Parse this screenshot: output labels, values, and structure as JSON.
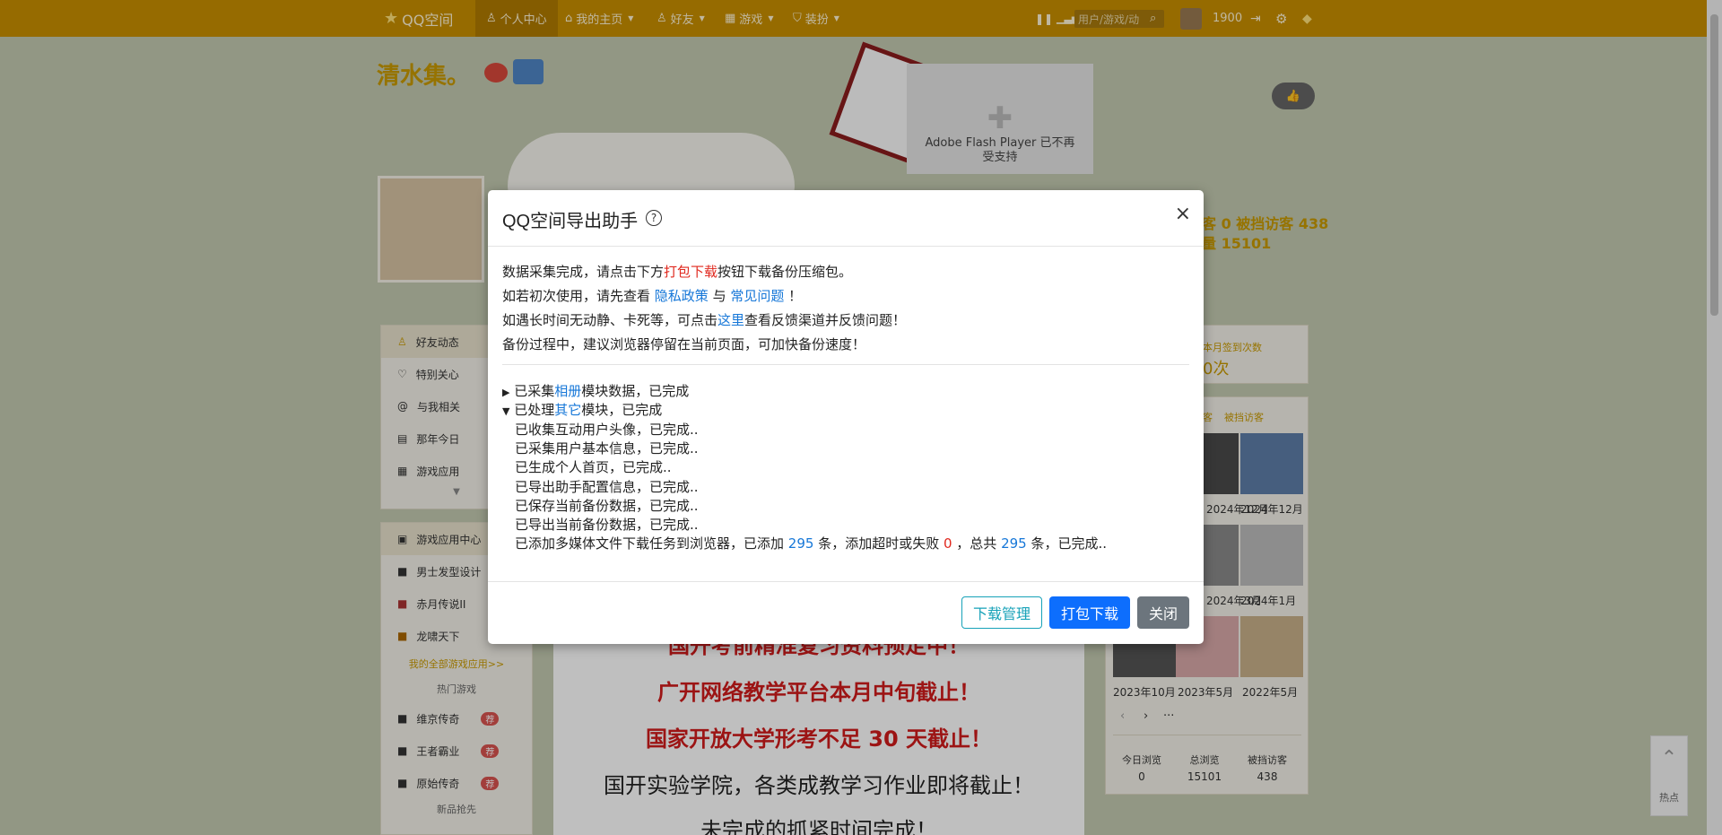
{
  "topbar": {
    "logo": "QQ空间",
    "personal": "个人中心",
    "home": "我的主页",
    "friends": "好友",
    "games": "游戏",
    "dress": "装扮",
    "search_placeholder": "用户/游戏/动",
    "year": "1900"
  },
  "space": {
    "title": "清水集。",
    "flash_notice": "Adobe Flash Player 已不再受支持"
  },
  "sidebar": {
    "items": [
      "好友动态",
      "特别关心",
      "与我相关",
      "那年今日",
      "游戏应用"
    ],
    "game_center": "游戏应用中心",
    "apps": [
      "男士发型设计",
      "赤月传说II",
      "龙啸天下"
    ],
    "all_games_link": "我的全部游戏应用>>",
    "hot_games_title": "热门游戏",
    "hot_games": [
      "维京传奇",
      "王者霸业",
      "原始传奇"
    ],
    "hot_badge": "荐",
    "new_title": "新品抢先"
  },
  "right_panel": {
    "stats_top": "客 0  被挡访客 438",
    "stats_total": "量 15101",
    "signin_label": "本月签到次数",
    "signin_value": "0次",
    "visitor_tabs": [
      "客",
      "被挡访客"
    ],
    "visitor_dates": [
      "2024年12月",
      "2024年12月",
      "2024年3月",
      "2024年1月",
      "2023年10月",
      "2023年5月",
      "2022年5月"
    ],
    "stats": [
      {
        "label": "今日浏览",
        "value": "0"
      },
      {
        "label": "总浏览",
        "value": "15101"
      },
      {
        "label": "被挡访客",
        "value": "438"
      }
    ]
  },
  "notice_lines": [
    "国开考前精准复习资料预定中！",
    "广开网络教学平台本月中旬截止！",
    "国家开放大学形考不足 30 天截止！",
    "国开实验学院，各类成教学习作业即将截止！",
    "未完成的抓紧时间完成！"
  ],
  "dialog": {
    "title": "QQ空间导出助手",
    "line1_a": "数据采集完成，请点击下方",
    "line1_b": "打包下载",
    "line1_c": "按钮下载备份压缩包。",
    "line2_a": "如若初次使用，请先查看 ",
    "line2_b": "隐私政策",
    "line2_c": " 与 ",
    "line2_d": "常见问题",
    "line2_e": " ！",
    "line3_a": "如遇长时间无动静、卡死等，可点击",
    "line3_b": "这里",
    "line3_c": "查看反馈渠道并反馈问题！",
    "line4": "备份过程中，建议浏览器停留在当前页面，可加快备份速度！",
    "album_a": "已采集",
    "album_b": "相册",
    "album_c": "模块数据，已完成",
    "other_a": "已处理",
    "other_b": "其它",
    "other_c": "模块，已完成",
    "steps": [
      "已收集互动用户头像，已完成..",
      "已采集用户基本信息，已完成..",
      "已生成个人首页，已完成..",
      "已导出助手配置信息，已完成..",
      "已保存当前备份数据，已完成..",
      "已导出当前备份数据，已完成.."
    ],
    "media_a": "已添加多媒体文件下载任务到浏览器，已添加 ",
    "media_added": "295",
    "media_b": " 条，添加超时或失败 ",
    "media_failed": "0",
    "media_c": " ，总共 ",
    "media_total": "295",
    "media_d": " 条，已完成..",
    "btn_manage": "下载管理",
    "btn_download": "打包下载",
    "btn_close": "关闭"
  },
  "scroll_top": {
    "label": "热点"
  }
}
